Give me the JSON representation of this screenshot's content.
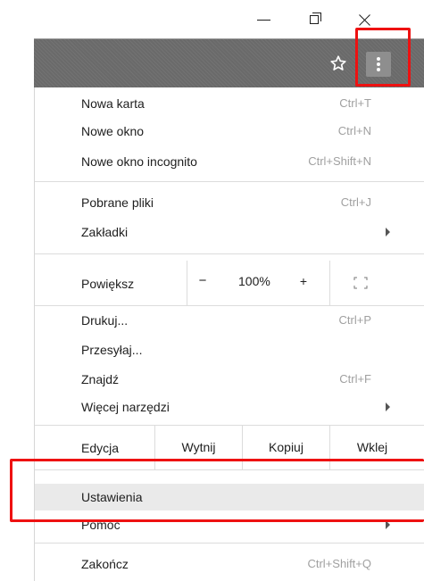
{
  "window": {
    "minimize_icon": "minimize-icon",
    "restore_icon": "restore-icon",
    "close_icon": "close-icon"
  },
  "toolbar": {
    "bookmark_icon": "star-icon",
    "menu_icon": "three-dots-vertical-icon"
  },
  "menu": {
    "group1": [
      {
        "label": "Nowa karta",
        "shortcut": "Ctrl+T"
      },
      {
        "label": "Nowe okno",
        "shortcut": "Ctrl+N"
      },
      {
        "label": "Nowe okno incognito",
        "shortcut": "Ctrl+Shift+N"
      }
    ],
    "group2": [
      {
        "label": "Pobrane pliki",
        "shortcut": "Ctrl+J"
      },
      {
        "label": "Zakładki",
        "shortcut": ""
      }
    ],
    "zoom": {
      "label": "Powiększ",
      "minus": "−",
      "value": "100%",
      "plus": "+",
      "fullscreen_icon": "fullscreen-icon"
    },
    "group3": [
      {
        "label": "Drukuj...",
        "shortcut": "Ctrl+P"
      },
      {
        "label": "Przesyłaj...",
        "shortcut": ""
      },
      {
        "label": "Znajdź",
        "shortcut": "Ctrl+F"
      },
      {
        "label": "Więcej narzędzi",
        "shortcut": ""
      }
    ],
    "edit": {
      "label": "Edycja",
      "cut": "Wytnij",
      "copy": "Kopiuj",
      "paste": "Wklej"
    },
    "group4": [
      {
        "label": "Ustawienia",
        "shortcut": ""
      },
      {
        "label": "Pomoc",
        "shortcut": ""
      }
    ],
    "exit": {
      "label": "Zakończ",
      "shortcut": "Ctrl+Shift+Q"
    }
  },
  "colors": {
    "highlight": "#ee1111",
    "hover": "#eaeaea",
    "toolbar": "#6a6a6a"
  }
}
